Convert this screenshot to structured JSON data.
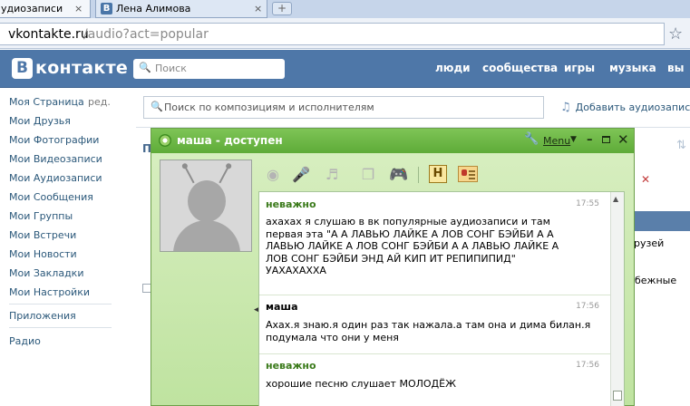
{
  "browser": {
    "tabs": [
      {
        "title": "удиозаписи",
        "close": "×"
      },
      {
        "title": "Лена Алимова",
        "close": "×",
        "favicon": "В"
      }
    ],
    "new_tab_symbol": "+",
    "url_host": "vkontakte.ru",
    "url_path": "/audio?act=popular",
    "star_glyph": "☆"
  },
  "vk": {
    "logo_letter": "В",
    "logo_text": "контакте",
    "search_placeholder": "Поиск",
    "nav": [
      "люди",
      "сообщества",
      "игры",
      "музыка",
      "вы"
    ],
    "colors": {
      "header": "#4e77a8",
      "link": "#2b587a"
    }
  },
  "sidebar": {
    "edit_label": "ред.",
    "items": [
      "Моя Страница",
      "Мои Друзья",
      "Мои Фотографии",
      "Мои Видеозаписи",
      "Мои Аудиозаписи",
      "Мои Сообщения",
      "Мои Группы",
      "Мои Встречи",
      "Мои Новости",
      "Мои Закладки",
      "Мои Настройки"
    ],
    "apps": "Приложения",
    "radio": "Радио"
  },
  "content": {
    "audio_search_placeholder": "Поиск по композициям и исполнителям",
    "add_audio": "Добавить аудиозапись",
    "peek": {
      "letter": "П",
      "friends": "рузей",
      "refugees": "бежные"
    }
  },
  "chat": {
    "title": "маша - доступен",
    "menu_label": "Menu",
    "controls": {
      "minimize": "–",
      "close": "✕"
    },
    "contact_h": "H",
    "messages": [
      {
        "sender": "неважно",
        "sender_color": "#3a7a1a",
        "time": "17:55",
        "text": "ахахах я слушаю в вк популярные аудиозаписи и там\nпервая эта \"А А ЛАВЬЮ ЛАЙКЕ А ЛОВ СОНГ БЭЙБИ А А\nЛАВЬЮ ЛАЙКЕ А ЛОВ СОНГ БЭЙБИ А А ЛАВЬЮ ЛАЙКЕ А\nЛОВ СОНГ БЭЙБИ ЭНД АЙ КИП ИТ РЕПИПИПИД\"\nУАХАХАХХА"
      },
      {
        "sender": "маша",
        "sender_color": "#000000",
        "time": "17:56",
        "text": "Ахах.я знаю.я один раз так нажала.а там она и дима билан.я\nподумала что они у меня"
      },
      {
        "sender": "неважно",
        "sender_color": "#3a7a1a",
        "time": "17:56",
        "text": "хорошие песню слушает МОЛОДЁЖ"
      }
    ]
  }
}
